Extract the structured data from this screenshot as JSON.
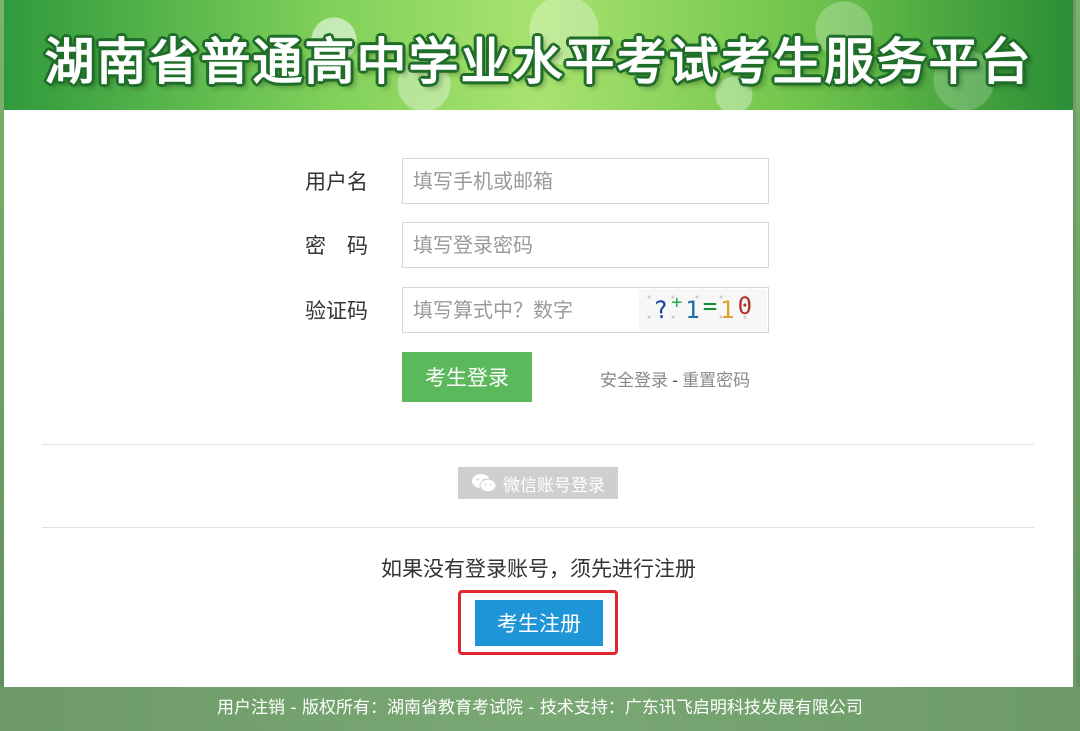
{
  "header": {
    "title": "湖南省普通高中学业水平考试考生服务平台"
  },
  "form": {
    "username": {
      "label": "用户名",
      "placeholder": "填写手机或邮箱"
    },
    "password": {
      "label": "密　码",
      "placeholder": "填写登录密码"
    },
    "captcha": {
      "label": "验证码",
      "placeholder": "填写算式中？数字",
      "image_chars": [
        "?",
        "+",
        "1",
        "=",
        "1",
        "0"
      ]
    },
    "login_button": "考生登录",
    "secure_login_link": "安全登录",
    "link_separator": "-",
    "reset_password_link": "重置密码"
  },
  "wechat": {
    "label": "微信账号登录",
    "icon": "wechat-icon"
  },
  "register": {
    "hint": "如果没有登录账号，须先进行注册",
    "button": "考生注册",
    "highlight_color": "#e3262e"
  },
  "footer": {
    "logout_link": "用户注销",
    "text": " - 版权所有：湖南省教育考试院 - 技术支持：广东讯飞启明科技发展有限公司"
  },
  "colors": {
    "login_button": "#5cb85c",
    "register_button": "#1e95d6",
    "wechat_button": "#cfcfcf"
  }
}
